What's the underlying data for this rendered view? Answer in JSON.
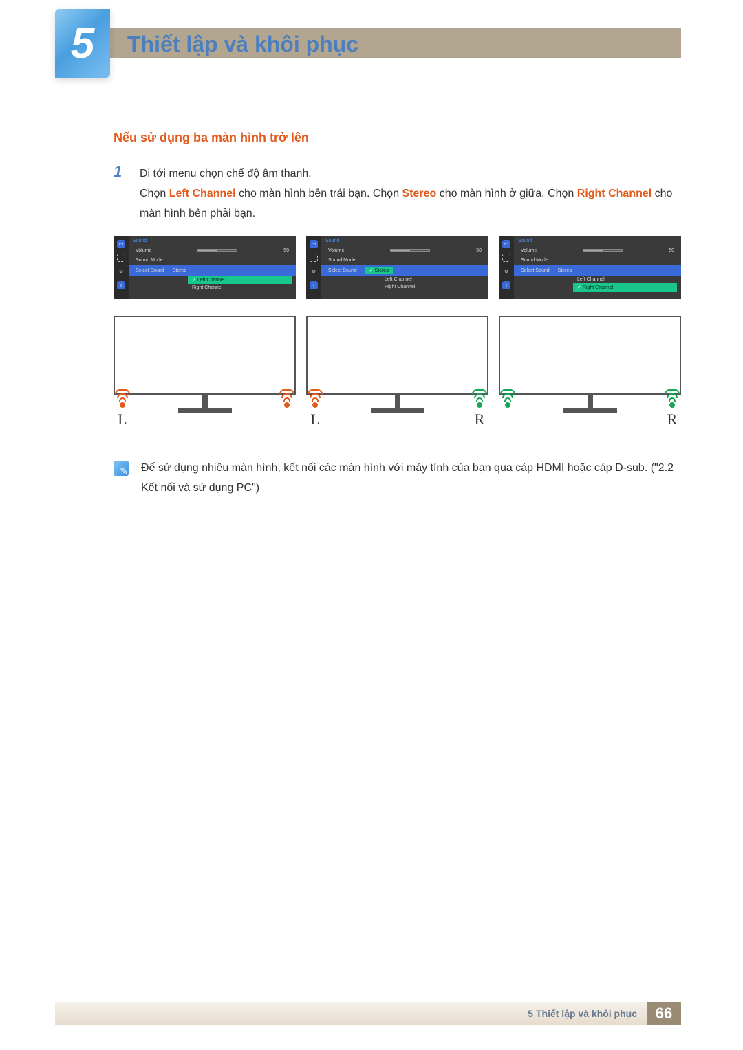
{
  "chapter": {
    "number": "5",
    "title": "Thiết lập và khôi phục"
  },
  "sub_heading": "Nếu sử dụng ba màn hình trở lên",
  "step": {
    "number": "1",
    "line1": "Đi tới menu chọn chế độ âm thanh.",
    "line2_a": "Chọn ",
    "kw_left": "Left Channel",
    "line2_b": " cho màn hình bên trái bạn. Chọn ",
    "kw_stereo": "Stereo",
    "line2_c": " cho màn hình ở giữa. Chọn ",
    "kw_right": "Right Channel",
    "line2_d": " cho màn hình bên phải bạn."
  },
  "osd": {
    "title": "Sound",
    "volume_label": "Volume",
    "volume_value": "50",
    "mode_label": "Sound Mode",
    "select_label": "Select Sound",
    "stereo": "Stereo",
    "left": "Left Channel",
    "right": "Right Channel"
  },
  "labels": {
    "L": "L",
    "R": "R"
  },
  "note": "Để sử dụng nhiều màn hình, kết nối các màn hình với máy tính của bạn qua cáp HDMI hoặc cáp D-sub. (\"2.2 Kết nối và sử dụng PC\")",
  "footer": {
    "text": "5 Thiết lập và khôi phục",
    "page": "66"
  }
}
